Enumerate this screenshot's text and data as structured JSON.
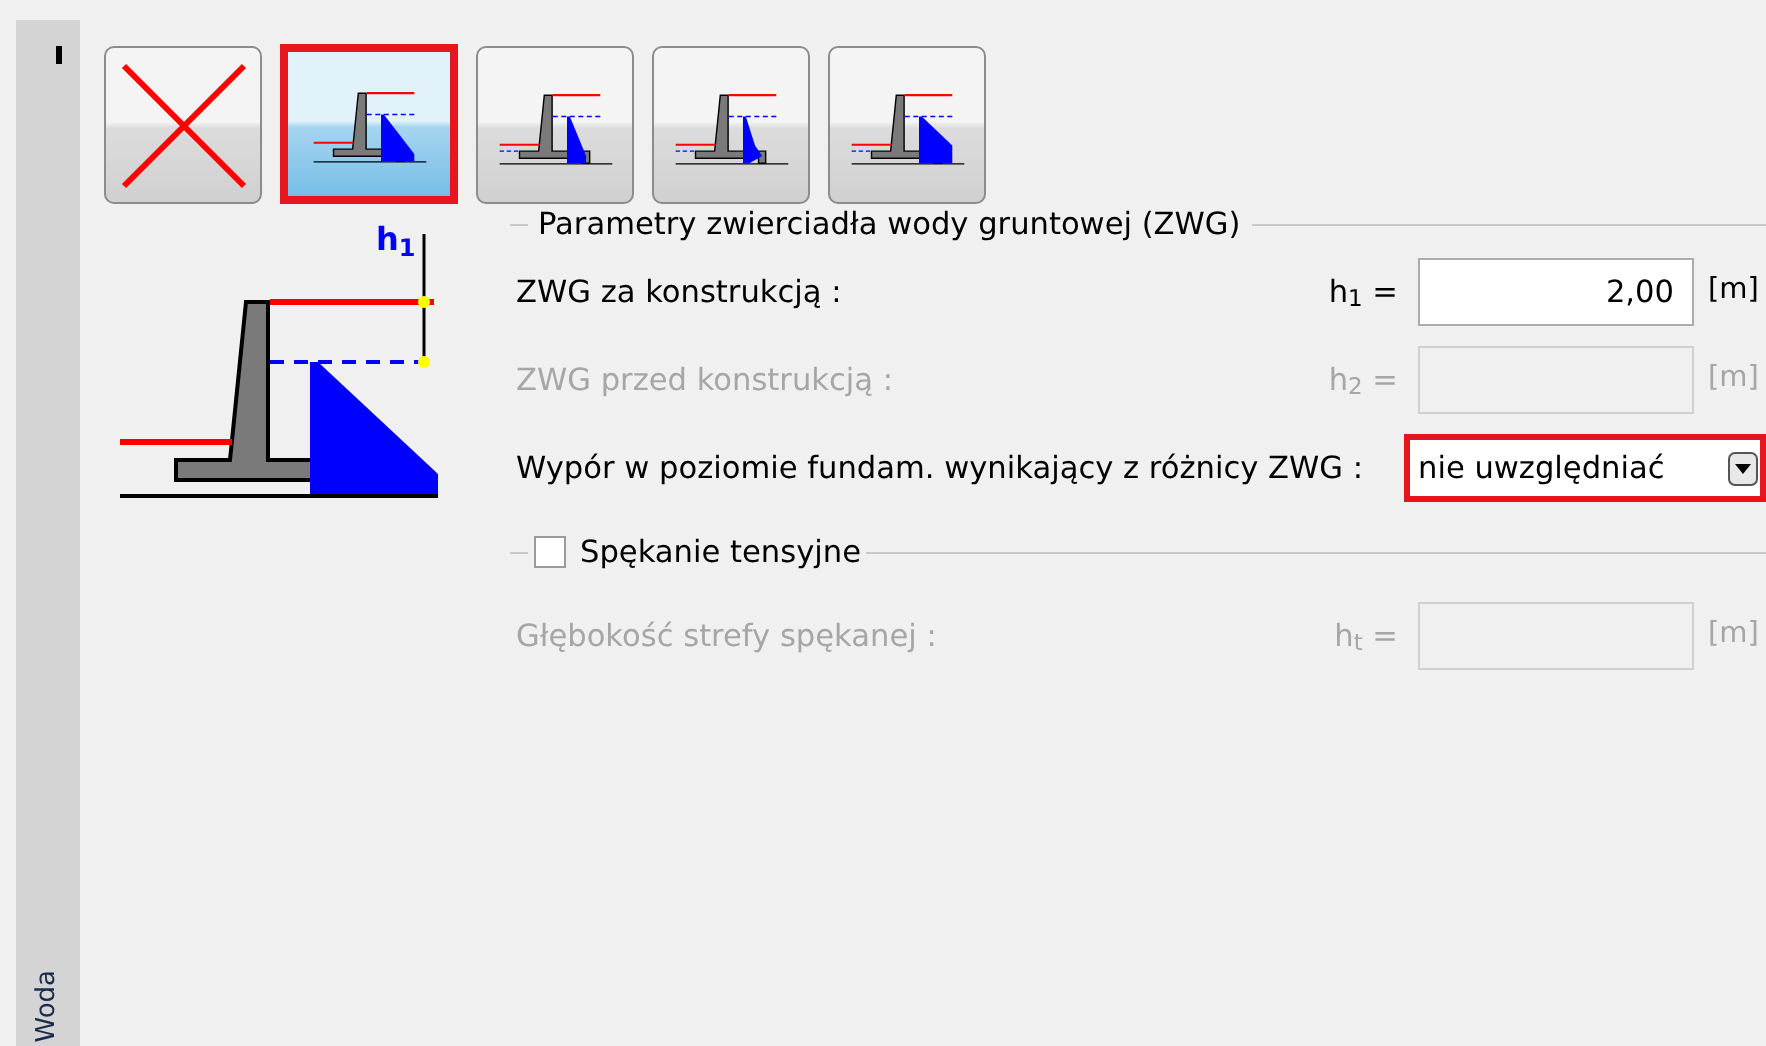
{
  "side_tab": {
    "label": "Woda"
  },
  "water_buttons": [
    {
      "kind": "none",
      "selected": false
    },
    {
      "kind": "behind",
      "selected": true
    },
    {
      "kind": "both",
      "selected": false
    },
    {
      "kind": "both-uplift",
      "selected": false
    },
    {
      "kind": "both-full",
      "selected": false
    }
  ],
  "diagram": {
    "label": "h$_{1}$"
  },
  "groundwater_group": {
    "title": "Parametry zwierciadła wody gruntowej (ZWG)",
    "rows": [
      {
        "kind": "input",
        "label": "ZWG za konstrukcją :",
        "symbol": "h$_{1}$ =",
        "value": "2,00",
        "unit": "[m]",
        "disabled": false
      },
      {
        "kind": "input",
        "label": "ZWG przed konstrukcją :",
        "symbol": "h$_{2}$ =",
        "unit": "[m]",
        "disabled": true
      },
      {
        "kind": "select",
        "label": "Wypór w poziomie fundam. wynikający z różnicy ZWG :",
        "value": "nie uwzględniać",
        "highlighted": true
      }
    ]
  },
  "tension_crack_group": {
    "label": "Spękanie tensyjne",
    "checked": false,
    "rows": [
      {
        "kind": "input",
        "label": "Głębokość strefy spękanej :",
        "symbol": "h$_{t}$ =",
        "unit": "[m]",
        "disabled": true
      }
    ]
  }
}
